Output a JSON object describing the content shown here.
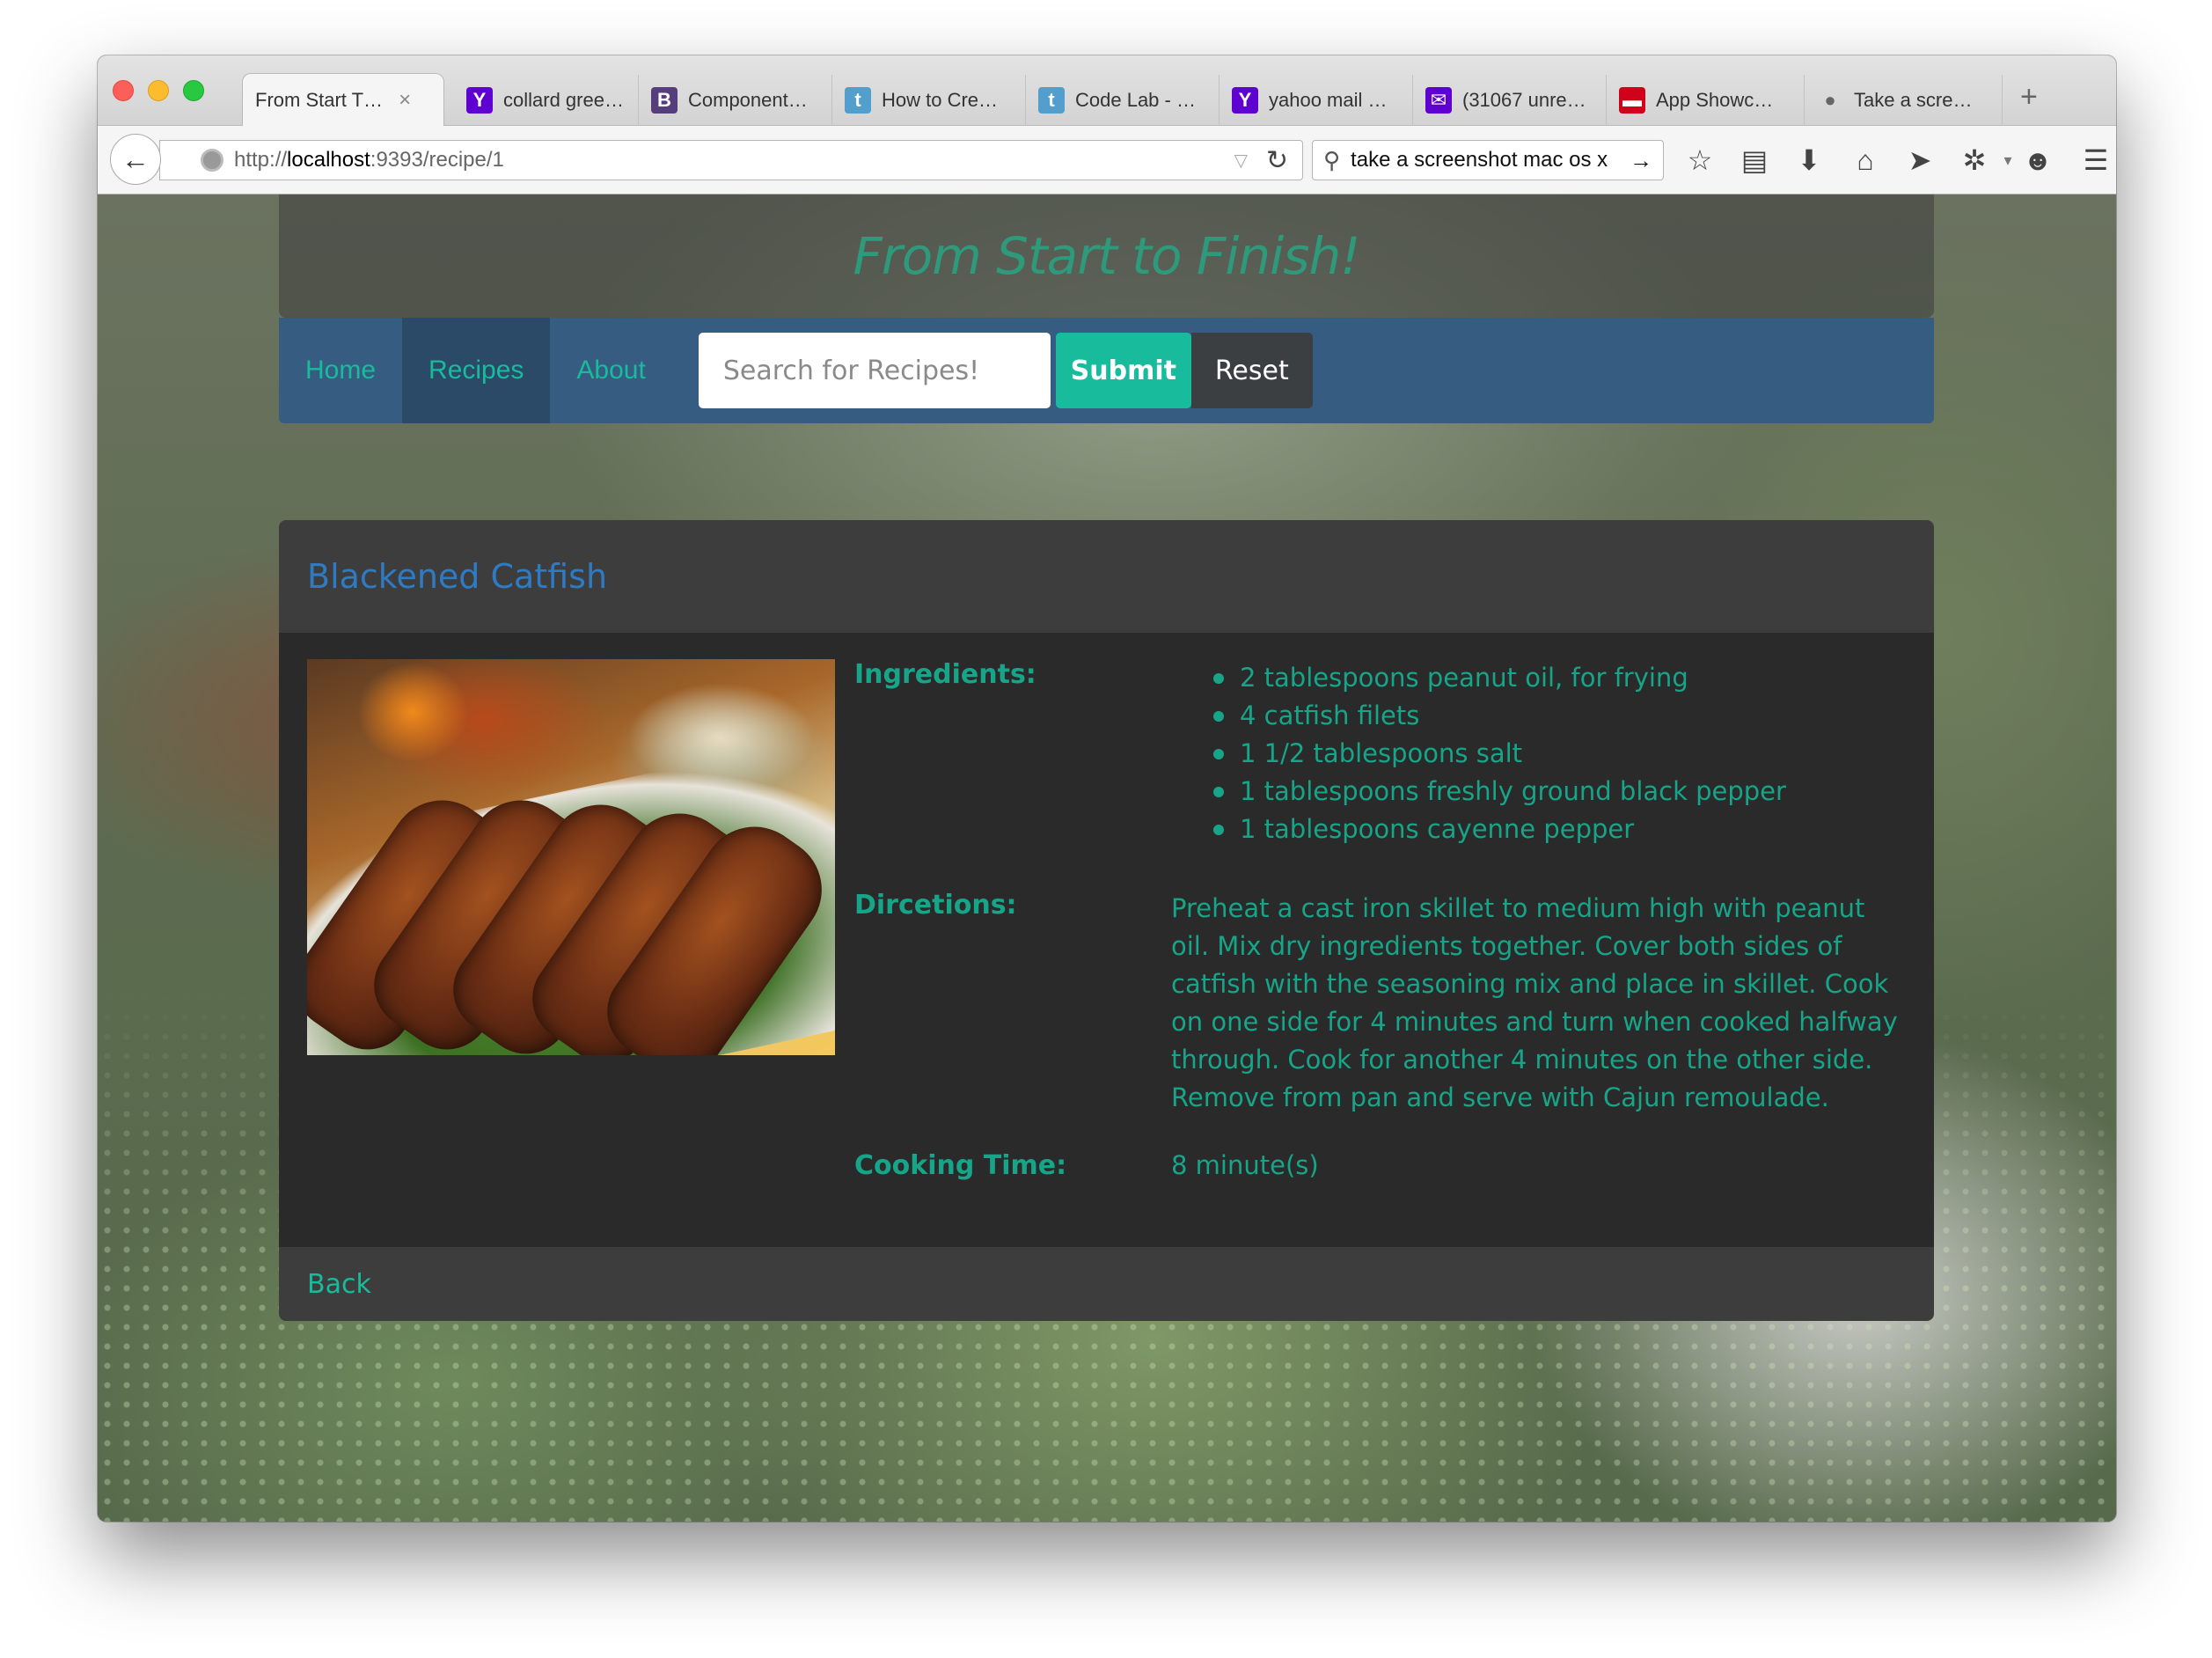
{
  "browser": {
    "tabs": [
      {
        "label": "From Start T…",
        "icon": "page-icon",
        "active": true
      },
      {
        "label": "collard gree…",
        "icon": "yahoo-icon",
        "color": "#5f01d1"
      },
      {
        "label": "Component…",
        "icon": "bootstrap-icon",
        "color": "#563d7c"
      },
      {
        "label": "How to Cre…",
        "icon": "tumblr-icon",
        "color": "#529ecc"
      },
      {
        "label": "Code Lab - …",
        "icon": "tumblr-icon",
        "color": "#529ecc"
      },
      {
        "label": "yahoo mail …",
        "icon": "yahoo-icon",
        "color": "#5f01d1"
      },
      {
        "label": "(31067 unre…",
        "icon": "mail-icon",
        "color": "#5f01d1"
      },
      {
        "label": "App Showc…",
        "icon": "showcase-icon",
        "color": "#d0021b"
      },
      {
        "label": "Take a scre…",
        "icon": "apple-icon"
      }
    ],
    "url_prefix": "http://",
    "url_host": "localhost",
    "url_rest": ":9393/recipe/1",
    "search_value": "take a screenshot mac os x"
  },
  "site": {
    "title": "From Start to Finish!",
    "nav": {
      "home": "Home",
      "recipes": "Recipes",
      "about": "About"
    },
    "search_placeholder": "Search for Recipes!",
    "submit_label": "Submit",
    "reset_label": "Reset"
  },
  "recipe": {
    "name": "Blackened Catfish",
    "ingredients_label": "Ingredients:",
    "ingredients": [
      "2 tablespoons peanut oil, for frying",
      "4 catfish filets",
      "1 1/2 tablespoons salt",
      "1 tablespoons freshly ground black pepper",
      "1 tablespoons cayenne pepper"
    ],
    "directions_label": "Dircetions:",
    "directions": "Preheat a cast iron skillet to medium high with peanut oil. Mix dry ingredients together. Cover both sides of catfish with the seasoning mix and place in skillet. Cook on one side for 4 minutes and turn when cooked halfway through. Cook for another 4 minutes on the other side. Remove from pan and serve with Cajun remoulade.",
    "cooking_time_label": "Cooking Time:",
    "cooking_time": "8 minute(s)",
    "back_label": "Back"
  },
  "colors": {
    "accent": "#18bc9c",
    "nav_bg": "#365c82",
    "heading_blue": "#2f7bc3"
  }
}
